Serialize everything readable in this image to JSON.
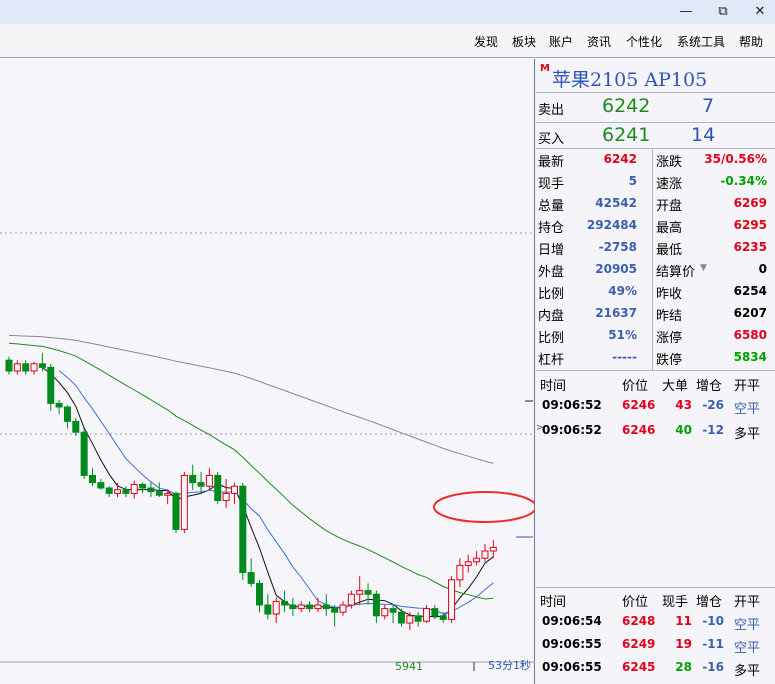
{
  "window": {
    "minimize": "—",
    "restore": "⧉",
    "close": "✕"
  },
  "menu": [
    "发现",
    "板块",
    "账户",
    "资讯",
    "个性化",
    "系统工具",
    "帮助"
  ],
  "chart": {
    "bottom_label": "5941",
    "time_label": "53分1秒",
    "candles": [
      {
        "o": 6286,
        "h": 6288,
        "l": 6278,
        "c": 6280
      },
      {
        "o": 6280,
        "h": 6286,
        "l": 6278,
        "c": 6284
      },
      {
        "o": 6284,
        "h": 6286,
        "l": 6278,
        "c": 6280
      },
      {
        "o": 6280,
        "h": 6285,
        "l": 6278,
        "c": 6284
      },
      {
        "o": 6284,
        "h": 6290,
        "l": 6280,
        "c": 6282
      },
      {
        "o": 6282,
        "h": 6284,
        "l": 6258,
        "c": 6262
      },
      {
        "o": 6262,
        "h": 6264,
        "l": 6256,
        "c": 6260
      },
      {
        "o": 6260,
        "h": 6261,
        "l": 6248,
        "c": 6252
      },
      {
        "o": 6252,
        "h": 6254,
        "l": 6244,
        "c": 6246
      },
      {
        "o": 6246,
        "h": 6248,
        "l": 6220,
        "c": 6222
      },
      {
        "o": 6222,
        "h": 6226,
        "l": 6216,
        "c": 6218
      },
      {
        "o": 6218,
        "h": 6220,
        "l": 6214,
        "c": 6215
      },
      {
        "o": 6215,
        "h": 6216,
        "l": 6210,
        "c": 6212
      },
      {
        "o": 6212,
        "h": 6218,
        "l": 6210,
        "c": 6214
      },
      {
        "o": 6214,
        "h": 6216,
        "l": 6210,
        "c": 6212
      },
      {
        "o": 6212,
        "h": 6219,
        "l": 6209,
        "c": 6217
      },
      {
        "o": 6217,
        "h": 6218,
        "l": 6212,
        "c": 6215
      },
      {
        "o": 6215,
        "h": 6218,
        "l": 6210,
        "c": 6213
      },
      {
        "o": 6213,
        "h": 6218,
        "l": 6210,
        "c": 6211
      },
      {
        "o": 6211,
        "h": 6214,
        "l": 6206,
        "c": 6212
      },
      {
        "o": 6212,
        "h": 6213,
        "l": 6190,
        "c": 6192
      },
      {
        "o": 6192,
        "h": 6224,
        "l": 6190,
        "c": 6222
      },
      {
        "o": 6222,
        "h": 6228,
        "l": 6214,
        "c": 6218
      },
      {
        "o": 6218,
        "h": 6224,
        "l": 6212,
        "c": 6216
      },
      {
        "o": 6216,
        "h": 6226,
        "l": 6214,
        "c": 6222
      },
      {
        "o": 6222,
        "h": 6224,
        "l": 6206,
        "c": 6208
      },
      {
        "o": 6208,
        "h": 6220,
        "l": 6204,
        "c": 6212
      },
      {
        "o": 6212,
        "h": 6218,
        "l": 6206,
        "c": 6216
      },
      {
        "o": 6216,
        "h": 6218,
        "l": 6164,
        "c": 6168
      },
      {
        "o": 6168,
        "h": 6176,
        "l": 6160,
        "c": 6162
      },
      {
        "o": 6162,
        "h": 6164,
        "l": 6146,
        "c": 6150
      },
      {
        "o": 6150,
        "h": 6156,
        "l": 6142,
        "c": 6145
      },
      {
        "o": 6145,
        "h": 6154,
        "l": 6140,
        "c": 6152
      },
      {
        "o": 6152,
        "h": 6158,
        "l": 6146,
        "c": 6150
      },
      {
        "o": 6150,
        "h": 6154,
        "l": 6144,
        "c": 6148
      },
      {
        "o": 6148,
        "h": 6152,
        "l": 6146,
        "c": 6150
      },
      {
        "o": 6150,
        "h": 6152,
        "l": 6146,
        "c": 6148
      },
      {
        "o": 6148,
        "h": 6154,
        "l": 6146,
        "c": 6150
      },
      {
        "o": 6150,
        "h": 6156,
        "l": 6144,
        "c": 6148
      },
      {
        "o": 6148,
        "h": 6150,
        "l": 6138,
        "c": 6146
      },
      {
        "o": 6146,
        "h": 6152,
        "l": 6144,
        "c": 6150
      },
      {
        "o": 6150,
        "h": 6158,
        "l": 6148,
        "c": 6156
      },
      {
        "o": 6156,
        "h": 6166,
        "l": 6150,
        "c": 6158
      },
      {
        "o": 6158,
        "h": 6162,
        "l": 6150,
        "c": 6156
      },
      {
        "o": 6156,
        "h": 6158,
        "l": 6140,
        "c": 6144
      },
      {
        "o": 6144,
        "h": 6150,
        "l": 6142,
        "c": 6148
      },
      {
        "o": 6148,
        "h": 6150,
        "l": 6140,
        "c": 6146
      },
      {
        "o": 6146,
        "h": 6148,
        "l": 6138,
        "c": 6140
      },
      {
        "o": 6140,
        "h": 6146,
        "l": 6136,
        "c": 6144
      },
      {
        "o": 6144,
        "h": 6146,
        "l": 6138,
        "c": 6141
      },
      {
        "o": 6141,
        "h": 6150,
        "l": 6140,
        "c": 6148
      },
      {
        "o": 6148,
        "h": 6150,
        "l": 6142,
        "c": 6144
      },
      {
        "o": 6144,
        "h": 6146,
        "l": 6140,
        "c": 6142
      },
      {
        "o": 6142,
        "h": 6166,
        "l": 6140,
        "c": 6164
      },
      {
        "o": 6164,
        "h": 6176,
        "l": 6160,
        "c": 6172
      },
      {
        "o": 6172,
        "h": 6178,
        "l": 6168,
        "c": 6174
      },
      {
        "o": 6174,
        "h": 6180,
        "l": 6172,
        "c": 6176
      },
      {
        "o": 6176,
        "h": 6184,
        "l": 6174,
        "c": 6180
      },
      {
        "o": 6180,
        "h": 6186,
        "l": 6176,
        "c": 6182
      }
    ]
  },
  "quote": {
    "title": "苹果2105  AP105",
    "sell": {
      "label": "卖出",
      "price": "6242",
      "volume": "7"
    },
    "buy": {
      "label": "买入",
      "price": "6241",
      "volume": "14"
    },
    "stats": [
      {
        "label": "最新",
        "value": "6242",
        "color": "red",
        "label2": "涨跌",
        "value2": "35/0.56%",
        "color2": "red"
      },
      {
        "label": "现手",
        "value": "5",
        "color": "blue",
        "label2": "速涨",
        "value2": "-0.34%",
        "color2": "green"
      },
      {
        "label": "总量",
        "value": "42542",
        "color": "blue",
        "label2": "开盘",
        "value2": "6269",
        "color2": "red"
      },
      {
        "label": "持仓",
        "value": "292484",
        "color": "blue",
        "label2": "最高",
        "value2": "6295",
        "color2": "red"
      },
      {
        "label": "日增",
        "value": "-2758",
        "color": "blue",
        "label2": "最低",
        "value2": "6235",
        "color2": "red"
      },
      {
        "label": "外盘",
        "value": "20905",
        "color": "blue",
        "label2": "结算价",
        "value2": "0",
        "color2": "black"
      },
      {
        "label": "比例",
        "value": "49%",
        "color": "blue",
        "label2": "昨收",
        "value2": "6254",
        "color2": "black"
      },
      {
        "label": "内盘",
        "value": "21637",
        "color": "blue",
        "label2": "昨结",
        "value2": "6207",
        "color2": "black"
      },
      {
        "label": "比例",
        "value": "51%",
        "color": "blue",
        "label2": "涨停",
        "value2": "6580",
        "color2": "red"
      },
      {
        "label": "杠杆",
        "value": "-----",
        "color": "blue",
        "label2": "跌停",
        "value2": "5834",
        "color2": "green"
      }
    ]
  },
  "trades1": {
    "headers": [
      "时间",
      "价位",
      "大单",
      "增仓",
      "开平"
    ],
    "rows": [
      {
        "time": "09:06:52",
        "price": "6246",
        "qty": "43",
        "chg": "-26",
        "type": "空平",
        "qty_color": "red",
        "type_color": "blue"
      },
      {
        "time": "09:06:52",
        "price": "6246",
        "qty": "40",
        "chg": "-12",
        "type": "多平",
        "qty_color": "green",
        "type_color": "black"
      }
    ]
  },
  "trades2": {
    "headers": [
      "时间",
      "价位",
      "现手",
      "增仓",
      "开平"
    ],
    "rows": [
      {
        "time": "09:06:54",
        "price": "6248",
        "qty": "11",
        "chg": "-10",
        "type": "空平",
        "qty_color": "red",
        "type_color": "blue"
      },
      {
        "time": "09:06:55",
        "price": "6249",
        "qty": "19",
        "chg": "-11",
        "type": "空平",
        "qty_color": "red",
        "type_color": "blue"
      },
      {
        "time": "09:06:55",
        "price": "6245",
        "qty": "28",
        "chg": "-16",
        "type": "多平",
        "qty_color": "green",
        "type_color": "black"
      }
    ]
  },
  "colors": {
    "up": "#e0001b",
    "down": "#008a1e",
    "ma5": "#111111",
    "ma10": "#3a6fd6",
    "ma20": "#1f8a1f",
    "ma60": "#8a8a8a",
    "highlight": "#e83030"
  }
}
